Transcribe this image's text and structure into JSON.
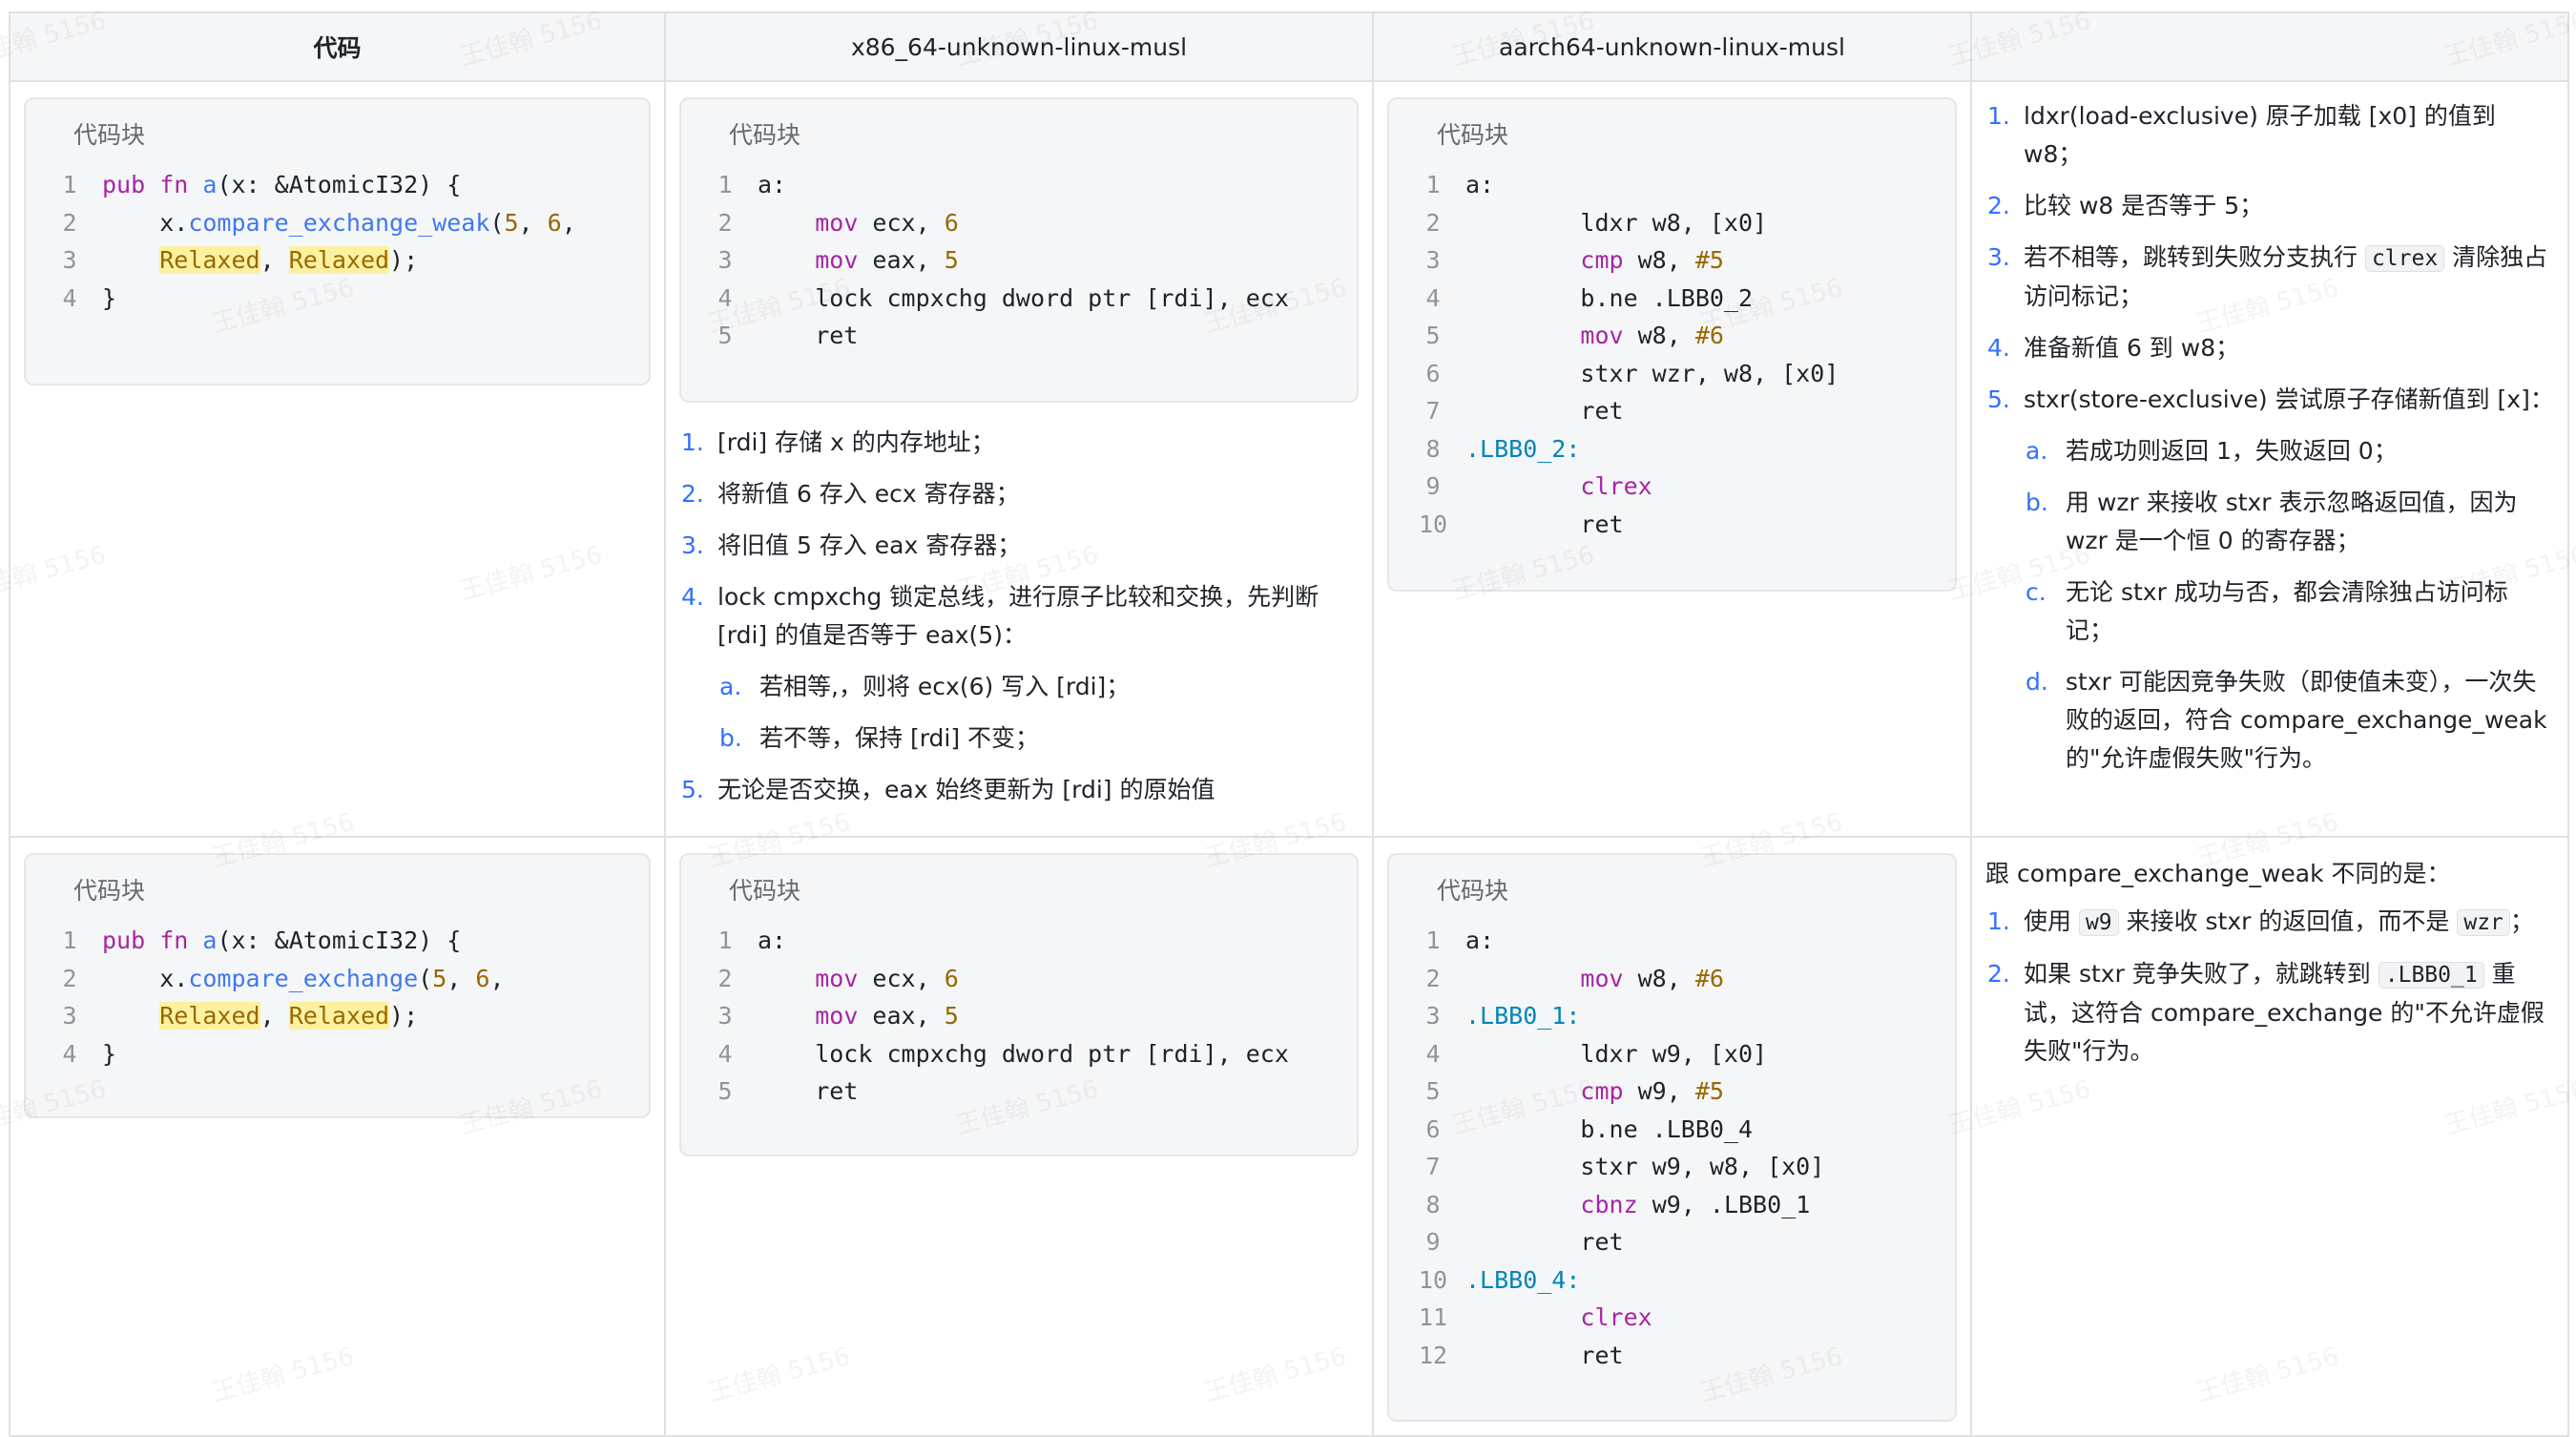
{
  "table": {
    "headers": [
      "代码",
      "x86_64-unknown-linux-musl",
      "aarch64-unknown-linux-musl",
      ""
    ],
    "code_block_title": "代码块"
  },
  "row1": {
    "rust_code": [
      [
        [
          "kw",
          "pub "
        ],
        [
          "kw",
          "fn "
        ],
        [
          "fn",
          "a"
        ],
        [
          "cd",
          "(x: &AtomicI32) {"
        ]
      ],
      [
        [
          "cd",
          "    x."
        ],
        [
          "fn",
          "compare_exchange_weak"
        ],
        [
          "cd",
          "("
        ],
        [
          "num",
          "5"
        ],
        [
          "cd",
          ", "
        ],
        [
          "num",
          "6"
        ],
        [
          "cd",
          ","
        ]
      ],
      [
        [
          "cd",
          "    "
        ],
        [
          "hl",
          "Relaxed"
        ],
        [
          "cd",
          ", "
        ],
        [
          "hl",
          "Relaxed"
        ],
        [
          "cd",
          ");"
        ]
      ],
      [
        [
          "cd",
          "}"
        ]
      ]
    ],
    "x86_code": [
      [
        [
          "cd",
          "a:"
        ]
      ],
      [
        [
          "cd",
          "    "
        ],
        [
          "kw",
          "mov"
        ],
        [
          "cd",
          " ecx, "
        ],
        [
          "num",
          "6"
        ]
      ],
      [
        [
          "cd",
          "    "
        ],
        [
          "kw",
          "mov"
        ],
        [
          "cd",
          " eax, "
        ],
        [
          "num",
          "5"
        ]
      ],
      [
        [
          "cd",
          "    lock cmpxchg dword ptr [rdi], ecx"
        ]
      ],
      [
        [
          "cd",
          "    ret"
        ]
      ]
    ],
    "x86_notes": [
      {
        "text": "[rdi] 存储 x 的内存地址；"
      },
      {
        "text": "将新值 6 存入 ecx 寄存器；"
      },
      {
        "text": "将旧值 5 存入 eax 寄存器；"
      },
      {
        "text": "lock cmpxchg 锁定总线，进行原子比较和交换，先判断 [rdi] 的值是否等于 eax(5)：",
        "sub": [
          "若相等,，则将 ecx(6) 写入 [rdi]；",
          "若不等，保持 [rdi] 不变；"
        ]
      },
      {
        "text": "无论是否交换，eax 始终更新为 [rdi] 的原始值"
      }
    ],
    "arm_code": [
      [
        [
          "cd",
          "a:"
        ]
      ],
      [
        [
          "cd",
          "        ldxr w8, [x0]"
        ]
      ],
      [
        [
          "cd",
          "        "
        ],
        [
          "kw",
          "cmp"
        ],
        [
          "cd",
          " w8, "
        ],
        [
          "num",
          "#5"
        ]
      ],
      [
        [
          "cd",
          "        b.ne .LBB0_2"
        ]
      ],
      [
        [
          "cd",
          "        "
        ],
        [
          "kw",
          "mov"
        ],
        [
          "cd",
          " w8, "
        ],
        [
          "num",
          "#6"
        ]
      ],
      [
        [
          "cd",
          "        stxr wzr, w8, [x0]"
        ]
      ],
      [
        [
          "cd",
          "        ret"
        ]
      ],
      [
        [
          "lbl",
          ".LBB0_2:"
        ]
      ],
      [
        [
          "cd",
          "        "
        ],
        [
          "kw",
          "clrex"
        ]
      ],
      [
        [
          "cd",
          "        ret"
        ]
      ]
    ],
    "arm_notes": [
      {
        "parts": [
          [
            "t",
            "ldxr(load-exclusive) 原子加载 [x0] 的值到 w8；"
          ]
        ]
      },
      {
        "parts": [
          [
            "t",
            "比较 w8 是否等于 5；"
          ]
        ]
      },
      {
        "parts": [
          [
            "t",
            "若不相等，跳转到失败分支执行 "
          ],
          [
            "c",
            "clrex"
          ],
          [
            "t",
            " 清除独占访问标记；"
          ]
        ]
      },
      {
        "parts": [
          [
            "t",
            "准备新值 6 到 w8；"
          ]
        ]
      },
      {
        "parts": [
          [
            "t",
            "stxr(store-exclusive) 尝试原子存储新值到 [x]："
          ]
        ],
        "sub": [
          "若成功则返回 1，失败返回 0；",
          "用 wzr 来接收 stxr 表示忽略返回值，因为 wzr 是一个恒 0 的寄存器；",
          "无论 stxr 成功与否，都会清除独占访问标记；",
          "stxr 可能因竞争失败（即使值未变），一次失败的返回，符合 compare_exchange_weak 的\"允许虚假失败\"行为。"
        ]
      }
    ]
  },
  "row2": {
    "rust_code": [
      [
        [
          "kw",
          "pub "
        ],
        [
          "kw",
          "fn "
        ],
        [
          "fn",
          "a"
        ],
        [
          "cd",
          "(x: &AtomicI32) {"
        ]
      ],
      [
        [
          "cd",
          "    x."
        ],
        [
          "fn",
          "compare_exchange"
        ],
        [
          "cd",
          "("
        ],
        [
          "num",
          "5"
        ],
        [
          "cd",
          ", "
        ],
        [
          "num",
          "6"
        ],
        [
          "cd",
          ","
        ]
      ],
      [
        [
          "cd",
          "    "
        ],
        [
          "hl",
          "Relaxed"
        ],
        [
          "cd",
          ", "
        ],
        [
          "hl",
          "Relaxed"
        ],
        [
          "cd",
          ");"
        ]
      ],
      [
        [
          "cd",
          "}"
        ]
      ]
    ],
    "x86_code": [
      [
        [
          "cd",
          "a:"
        ]
      ],
      [
        [
          "cd",
          "    "
        ],
        [
          "kw",
          "mov"
        ],
        [
          "cd",
          " ecx, "
        ],
        [
          "num",
          "6"
        ]
      ],
      [
        [
          "cd",
          "    "
        ],
        [
          "kw",
          "mov"
        ],
        [
          "cd",
          " eax, "
        ],
        [
          "num",
          "5"
        ]
      ],
      [
        [
          "cd",
          "    lock cmpxchg dword ptr [rdi], ecx"
        ]
      ],
      [
        [
          "cd",
          "    ret"
        ]
      ]
    ],
    "arm_code": [
      [
        [
          "cd",
          "a:"
        ]
      ],
      [
        [
          "cd",
          "        "
        ],
        [
          "kw",
          "mov"
        ],
        [
          "cd",
          " w8, "
        ],
        [
          "num",
          "#6"
        ]
      ],
      [
        [
          "lbl",
          ".LBB0_1:"
        ]
      ],
      [
        [
          "cd",
          "        ldxr w9, [x0]"
        ]
      ],
      [
        [
          "cd",
          "        "
        ],
        [
          "kw",
          "cmp"
        ],
        [
          "cd",
          " w9, "
        ],
        [
          "num",
          "#5"
        ]
      ],
      [
        [
          "cd",
          "        b.ne .LBB0_4"
        ]
      ],
      [
        [
          "cd",
          "        stxr w9, w8, [x0]"
        ]
      ],
      [
        [
          "cd",
          "        "
        ],
        [
          "kw",
          "cbnz"
        ],
        [
          "cd",
          " w9, .LBB0_1"
        ]
      ],
      [
        [
          "cd",
          "        ret"
        ]
      ],
      [
        [
          "lbl",
          ".LBB0_4:"
        ]
      ],
      [
        [
          "cd",
          "        "
        ],
        [
          "kw",
          "clrex"
        ]
      ],
      [
        [
          "cd",
          "        ret"
        ]
      ]
    ],
    "diff_intro": "跟 compare_exchange_weak 不同的是：",
    "diff_notes": [
      {
        "parts": [
          [
            "t",
            "使用 "
          ],
          [
            "c",
            "w9"
          ],
          [
            "t",
            " 来接收 stxr 的返回值，而不是 "
          ],
          [
            "c",
            "wzr"
          ],
          [
            "t",
            "；"
          ]
        ]
      },
      {
        "parts": [
          [
            "t",
            "如果 stxr 竞争失败了，就跳转到 "
          ],
          [
            "c",
            ".LBB0_1"
          ],
          [
            "t",
            " 重试，这符合 compare_exchange 的\"不允许虚假失败\"行为。"
          ]
        ]
      }
    ]
  },
  "watermark_text": "王佳翰 5156",
  "colors": {
    "accent": "#3370ff",
    "border": "#dee0e3",
    "code_bg": "#f5f6f7",
    "highlight": "#fbf1a0"
  }
}
